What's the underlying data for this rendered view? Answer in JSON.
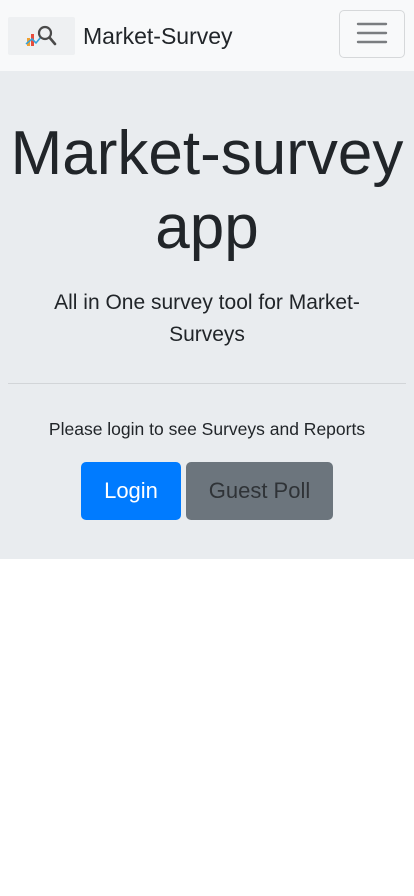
{
  "navbar": {
    "brand_text": "Market-Survey",
    "logo_icon": "chart-magnifier-icon",
    "toggler_icon": "hamburger-menu-icon"
  },
  "hero": {
    "title": "Market-survey app",
    "lead": "All in One survey tool for Market-Surveys",
    "info": "Please login to see Surveys and Reports"
  },
  "buttons": {
    "login_label": "Login",
    "guest_label": "Guest Poll"
  },
  "colors": {
    "navbar_bg": "#f8f9fa",
    "jumbotron_bg": "#e9ecef",
    "primary": "#007bff",
    "secondary": "#6c757d"
  }
}
